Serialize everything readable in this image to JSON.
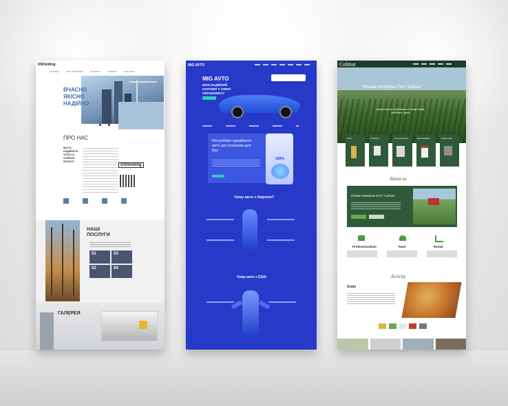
{
  "card1": {
    "logo": "DSHolding",
    "nav": [
      "ГОЛОВНА",
      "ПРО КОМПАНІЮ",
      "ПОСЛУГИ",
      "ГАЛЕРЕЯ",
      "КОНТАКТИ"
    ],
    "hero_title": "ВЧАСНО ЯКІСНО НАДІЙНО",
    "about_title": "ПРО НАС",
    "about_lead": "ВАСТЬ НАДІЙНІСТЬ ХОТІЛ І Б КОМПАНІ ПРОЕКТІ",
    "about_logo": "DSHolding",
    "services_title": "НАШІ ПОСЛУГИ",
    "services_items": [
      "01",
      "03",
      "02",
      "04"
    ],
    "gallery_title": "ГАЛЕРЕЯ"
  },
  "card2": {
    "logo": "MIG AVTO",
    "hero_title": "MIG AVTO",
    "hero_subtitle": "ВАШ НАДІЙНИЙ ПАРТНЕР У СФЕРІ АВТОБІЗНЕСУ",
    "section_offer": "Ми робимо придбання авто доступнішим для Вас",
    "badge_percent": "100%",
    "section_europe": "Чому авто з Європи?",
    "section_usa": "Чому авто з США"
  },
  "card3": {
    "logo": "Colmar",
    "hero_title": "Private enterprise Firm \"Colmar\"",
    "hero_sub": "import-export operations of scrap metal, fertilizers, grain",
    "categories": [
      "Grain",
      "Fertilizers",
      "Crop protection",
      "Microfertilizers",
      "Scrap metal"
    ],
    "about_script": "About us",
    "about_title": "Private enterprise Firm \"Colmar\"",
    "features": [
      "Professionalism",
      "Team",
      "Result"
    ],
    "activity_script": "Activity",
    "grain_title": "Grain"
  },
  "colors": {
    "blue": "#2639c9",
    "green": "#2f5a3a",
    "accent_green": "#6aa84f"
  }
}
